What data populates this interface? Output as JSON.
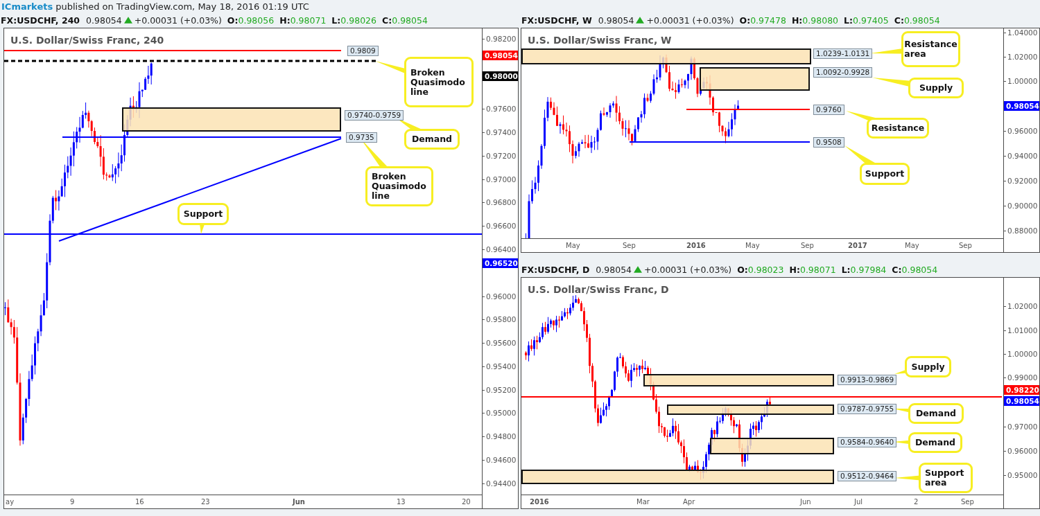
{
  "publisher": {
    "name": "ICmarkets",
    "text": "published on TradingView.com, May 18, 2016 01:19 UTC"
  },
  "panels": [
    {
      "symbol": "FX:USDCHF, 240",
      "price": "0.98054",
      "change_up": true,
      "change": "+0.00031 (+0.03%)",
      "ohlc": [
        {
          "label": "O:",
          "value": "0.98056"
        },
        {
          "label": "H:",
          "value": "0.98071"
        },
        {
          "label": "L:",
          "value": "0.98026"
        },
        {
          "label": "C:",
          "value": "0.98054"
        }
      ],
      "title": "U.S. Dollar/Swiss Franc, 240",
      "price_ticks": [
        "0.98200",
        "0.97600",
        "0.97400",
        "0.97200",
        "0.97000",
        "0.96800",
        "0.96600",
        "0.96400",
        "0.96000",
        "0.95800",
        "0.95600",
        "0.95400",
        "0.95200",
        "0.95000",
        "0.94800",
        "0.94600",
        "0.94400"
      ],
      "price_tags": [
        {
          "text": "0.98054",
          "color": "#ff0000"
        },
        {
          "text": "0.98000",
          "color": "#000000"
        },
        {
          "text": "0.96520",
          "color": "#0000ff"
        }
      ],
      "time_labels": [
        {
          "text": "ay",
          "bold": false
        },
        {
          "text": "9",
          "bold": false
        },
        {
          "text": "16",
          "bold": false
        },
        {
          "text": "23",
          "bold": false
        },
        {
          "text": "Jun",
          "bold": true
        },
        {
          "text": "13",
          "bold": false
        },
        {
          "text": "20",
          "bold": false
        }
      ],
      "levels": [
        {
          "kind": "line",
          "color": "#ff0000",
          "label": "0.9809"
        },
        {
          "kind": "dashed",
          "color": "#000000"
        },
        {
          "kind": "zone",
          "label": "0.9740-0.9759"
        },
        {
          "kind": "line",
          "color": "#0000ff",
          "label": "0.9735"
        },
        {
          "kind": "trendline",
          "color": "#0000ff"
        },
        {
          "kind": "line",
          "color": "#0000ff"
        }
      ],
      "callouts": [
        "Broken Quasimodo line",
        "Demand",
        "Broken Quasimodo line",
        "Support"
      ]
    },
    {
      "symbol": "FX:USDCHF, W",
      "price": "0.98054",
      "change_up": true,
      "change": "+0.00031 (+0.03%)",
      "ohlc": [
        {
          "label": "O:",
          "value": "0.97478"
        },
        {
          "label": "H:",
          "value": "0.98080"
        },
        {
          "label": "L:",
          "value": "0.97405"
        },
        {
          "label": "C:",
          "value": "0.98054"
        }
      ],
      "title": "U.S. Dollar/Swiss Franc, W",
      "price_ticks": [
        "1.04000",
        "1.02000",
        "1.00000",
        "0.96000",
        "0.94000",
        "0.92000",
        "0.90000",
        "0.88000"
      ],
      "price_tags": [
        {
          "text": "0.98054",
          "color": "#0000ff"
        }
      ],
      "time_labels": [
        {
          "text": "May",
          "bold": false
        },
        {
          "text": "Sep",
          "bold": false
        },
        {
          "text": "2016",
          "bold": true
        },
        {
          "text": "May",
          "bold": false
        },
        {
          "text": "Sep",
          "bold": false
        },
        {
          "text": "2017",
          "bold": true
        },
        {
          "text": "May",
          "bold": false
        },
        {
          "text": "Sep",
          "bold": false
        }
      ],
      "levels": [
        {
          "kind": "zone",
          "label": "1.0239-1.0131"
        },
        {
          "kind": "zone",
          "label": "1.0092-0.9928"
        },
        {
          "kind": "line",
          "color": "#ff0000",
          "label": "0.9760"
        },
        {
          "kind": "line",
          "color": "#0000ff",
          "label": "0.9508"
        }
      ],
      "callouts": [
        "Resistance area",
        "Supply",
        "Resistance",
        "Support"
      ]
    },
    {
      "symbol": "FX:USDCHF, D",
      "price": "0.98054",
      "change_up": true,
      "change": "+0.00031 (+0.03%)",
      "ohlc": [
        {
          "label": "O:",
          "value": "0.98023"
        },
        {
          "label": "H:",
          "value": "0.98071"
        },
        {
          "label": "L:",
          "value": "0.97984"
        },
        {
          "label": "C:",
          "value": "0.98054"
        }
      ],
      "title": "U.S. Dollar/Swiss Franc, D",
      "price_ticks": [
        "1.02000",
        "1.01000",
        "1.00000",
        "0.99000",
        "0.97000",
        "0.96000",
        "0.95000"
      ],
      "price_tags": [
        {
          "text": "0.98220",
          "color": "#ff0000"
        },
        {
          "text": "0.98054",
          "color": "#0000ff"
        }
      ],
      "time_labels": [
        {
          "text": "2016",
          "bold": true
        },
        {
          "text": "Mar",
          "bold": false
        },
        {
          "text": "Apr",
          "bold": false
        },
        {
          "text": "Jun",
          "bold": false
        },
        {
          "text": "Jul",
          "bold": false
        },
        {
          "text": "2",
          "bold": false
        },
        {
          "text": "Sep",
          "bold": false
        }
      ],
      "levels": [
        {
          "kind": "zone",
          "label": "0.9913-0.9869"
        },
        {
          "kind": "line",
          "color": "#ff0000"
        },
        {
          "kind": "zone",
          "label": "0.9787-0.9755"
        },
        {
          "kind": "zone",
          "label": "0.9584-0.9640"
        },
        {
          "kind": "zone",
          "label": "0.9512-0.9464"
        }
      ],
      "callouts": [
        "Supply",
        "Demand",
        "Demand",
        "Support area"
      ]
    }
  ]
}
